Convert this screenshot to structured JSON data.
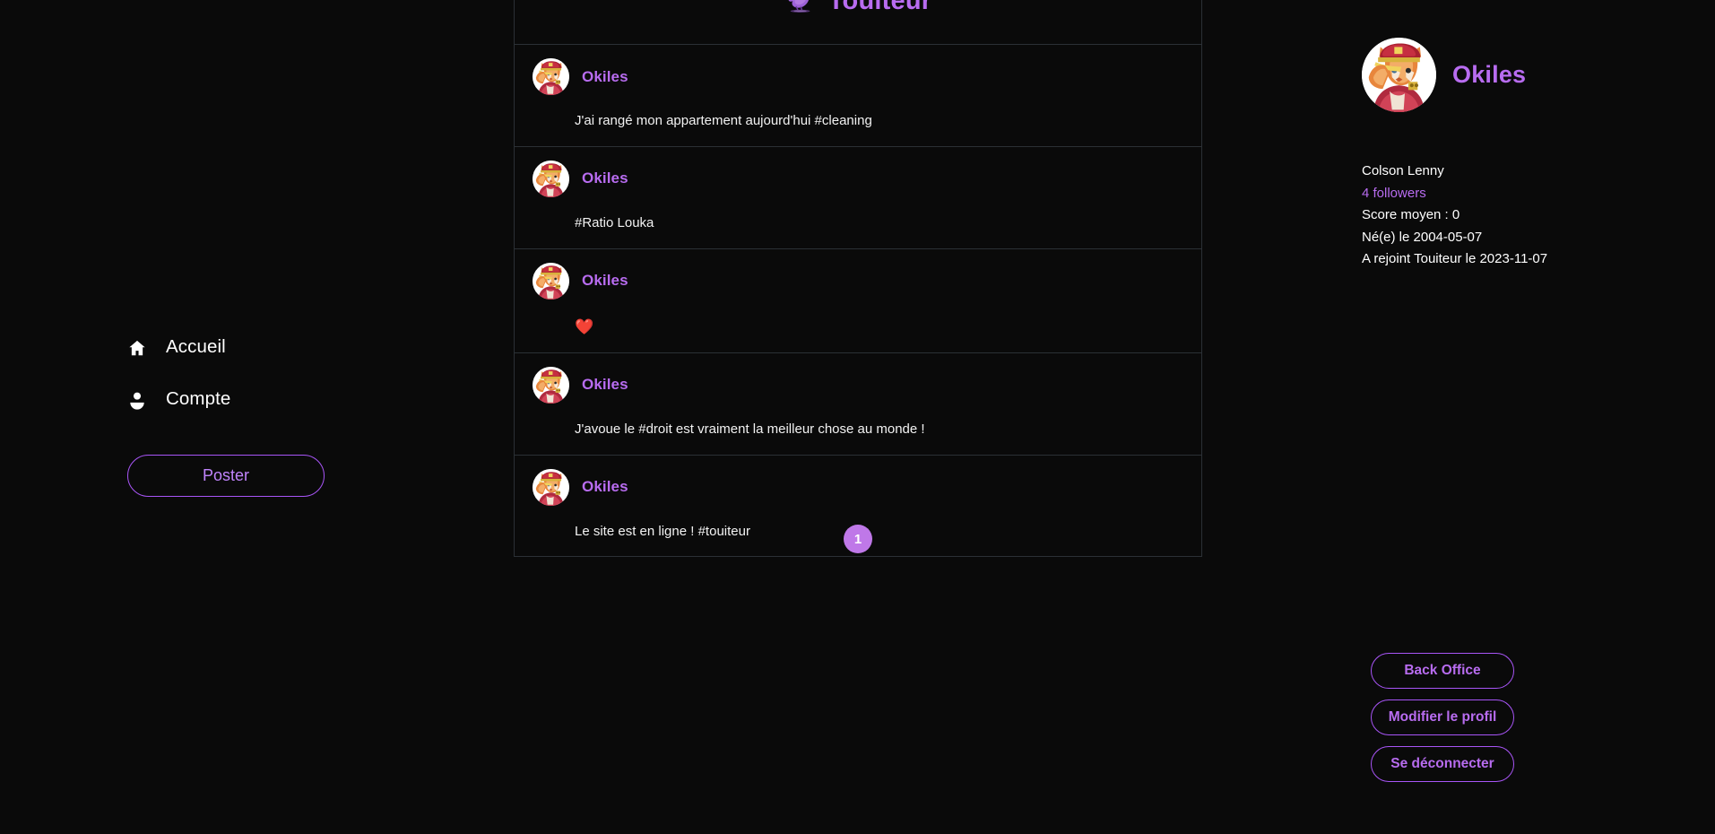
{
  "brand": {
    "title": "Touiteur",
    "logo_icon": "bird-icon"
  },
  "sidebar": {
    "items": [
      {
        "label": "Accueil",
        "icon": "home-icon"
      },
      {
        "label": "Compte",
        "icon": "person-icon"
      }
    ],
    "post_button": "Poster"
  },
  "feed": {
    "posts": [
      {
        "author": "Okiles",
        "text": "J'ai rangé mon appartement aujourd'hui #cleaning",
        "avatar_icon": "cat-salute-avatar"
      },
      {
        "author": "Okiles",
        "text": "#Ratio Louka",
        "avatar_icon": "cat-salute-avatar"
      },
      {
        "author": "Okiles",
        "text": "❤️",
        "avatar_icon": "cat-salute-avatar"
      },
      {
        "author": "Okiles",
        "text": "J'avoue le #droit est vraiment la meilleur chose au monde !",
        "avatar_icon": "cat-salute-avatar"
      },
      {
        "author": "Okiles",
        "text": "Le site est en ligne ! #touiteur",
        "avatar_icon": "cat-salute-avatar"
      }
    ],
    "pagination": {
      "current_page": "1"
    }
  },
  "profile": {
    "display_name": "Okiles",
    "avatar_icon": "cat-salute-avatar",
    "full_name": "Colson Lenny",
    "followers": "4 followers",
    "score": "Score moyen : 0",
    "birth": "Né(e) le 2004-05-07",
    "joined": "A rejoint Touiteur le 2023-11-07",
    "actions": [
      {
        "label": "Back Office"
      },
      {
        "label": "Modifier le profil"
      },
      {
        "label": "Se déconnecter"
      }
    ]
  },
  "colors": {
    "background": "#0a0a0a",
    "accent_purple": "#b86cf0",
    "border_purple": "#a855f7",
    "pagination_fill": "#bf78e8",
    "divider": "#2b3035",
    "text_primary": "#ffffff",
    "heart_red": "#e0245e"
  }
}
